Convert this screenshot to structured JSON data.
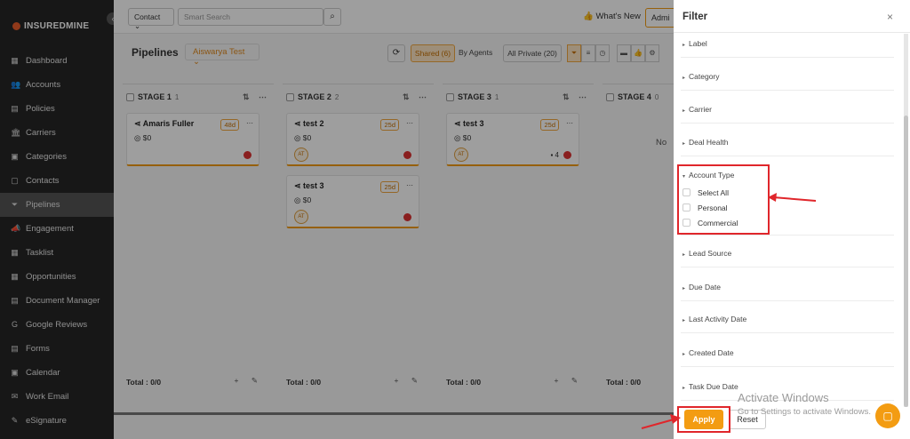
{
  "sidebar": {
    "logo": "INSUREDMINE",
    "collapse_icon": "‹",
    "items": [
      {
        "label": "Dashboard",
        "icon": "dashboard-icon",
        "glyph": "▦"
      },
      {
        "label": "Accounts",
        "icon": "accounts-icon",
        "glyph": "👥"
      },
      {
        "label": "Policies",
        "icon": "policies-icon",
        "glyph": "▤"
      },
      {
        "label": "Carriers",
        "icon": "carriers-icon",
        "glyph": "🏛"
      },
      {
        "label": "Categories",
        "icon": "categories-icon",
        "glyph": "▣"
      },
      {
        "label": "Contacts",
        "icon": "contacts-icon",
        "glyph": "▢"
      },
      {
        "label": "Pipelines",
        "icon": "pipelines-icon",
        "glyph": "⏷"
      },
      {
        "label": "Engagement",
        "icon": "engagement-icon",
        "glyph": "📣"
      },
      {
        "label": "Tasklist",
        "icon": "tasklist-icon",
        "glyph": "▦"
      },
      {
        "label": "Opportunities",
        "icon": "opportunities-icon",
        "glyph": "▦"
      },
      {
        "label": "Document Manager",
        "icon": "document-icon",
        "glyph": "▤"
      },
      {
        "label": "Google Reviews",
        "icon": "google-icon",
        "glyph": "G"
      },
      {
        "label": "Forms",
        "icon": "forms-icon",
        "glyph": "▤"
      },
      {
        "label": "Calendar",
        "icon": "calendar-icon",
        "glyph": "▣"
      },
      {
        "label": "Work Email",
        "icon": "email-icon",
        "glyph": "✉"
      },
      {
        "label": "eSignature",
        "icon": "signature-icon",
        "glyph": "✎"
      }
    ],
    "active": "Pipelines"
  },
  "topbar": {
    "contact_select": "Contact",
    "search_placeholder": "Smart Search",
    "whats_new": "What's New",
    "admin": "Admi"
  },
  "pipeline_header": {
    "title": "Pipelines",
    "pipeline_name": "Aiswarya Test",
    "shared": "Shared (6)",
    "by_agents": "By Agents",
    "all_private": "All Private (20)"
  },
  "stages": [
    {
      "name": "STAGE 1",
      "count": "1",
      "footer": "Total : 0/0",
      "cards": [
        {
          "title": "Amaris Fuller",
          "amount": "$0",
          "days": "48d",
          "avatar": ""
        }
      ]
    },
    {
      "name": "STAGE 2",
      "count": "2",
      "footer": "Total : 0/0",
      "cards": [
        {
          "title": "test 2",
          "amount": "$0",
          "days": "25d",
          "avatar": "AT"
        },
        {
          "title": "test 3",
          "amount": "$0",
          "days": "25d",
          "avatar": "AT"
        }
      ]
    },
    {
      "name": "STAGE 3",
      "count": "1",
      "footer": "Total : 0/0",
      "cards": [
        {
          "title": "test 3",
          "amount": "$0",
          "days": "25d",
          "avatar": "AT",
          "extra": "4"
        }
      ]
    },
    {
      "name": "STAGE 4",
      "count": "0",
      "footer": "Total : 0/0",
      "cards": [],
      "no_data": "No"
    }
  ],
  "filter": {
    "title": "Filter",
    "close": "×",
    "sections": [
      "Label",
      "Category",
      "Carrier",
      "Deal Health",
      "Account Type",
      "Lead Source",
      "Due Date",
      "Last Activity Date",
      "Created Date",
      "Task Due Date"
    ],
    "account_type_options": [
      "Select All",
      "Personal",
      "Commercial"
    ],
    "apply": "Apply",
    "reset": "Reset"
  },
  "watermark": {
    "line1": "Activate Windows",
    "line2": "Go to Settings to activate Windows."
  },
  "colors": {
    "accent": "#f39c12",
    "annotation": "#e0262b",
    "sidebar_bg": "#262626"
  }
}
